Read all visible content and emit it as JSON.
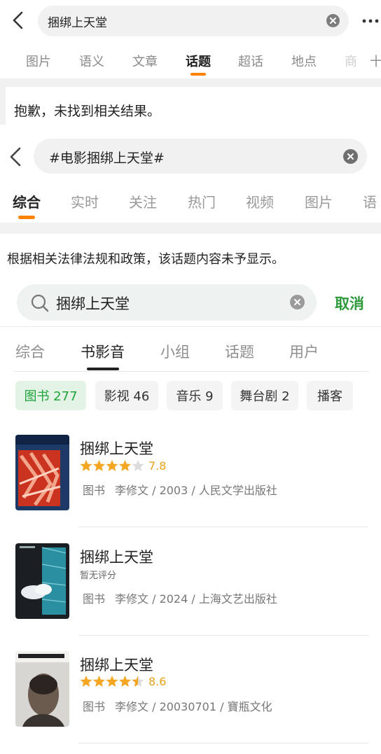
{
  "panel1": {
    "search_query": "捆绑上天堂",
    "tabs": [
      "图片",
      "语义",
      "文章",
      "话题",
      "超话",
      "地点",
      "商",
      "十"
    ],
    "active_tab": "话题",
    "message": "抱歉，未找到相关结果。",
    "accent_color": "#ff8200"
  },
  "panel2": {
    "search_query": "#电影捆绑上天堂#",
    "tabs": [
      "综合",
      "实时",
      "关注",
      "热门",
      "视频",
      "图片",
      "语"
    ],
    "active_tab": "综合",
    "message": "根据相关法律法规和政策，该话题内容未予显示。",
    "accent_color": "#ff8200"
  },
  "panel3": {
    "search_query": "捆绑上天堂",
    "cancel_label": "取消",
    "tabs": [
      "综合",
      "书影音",
      "小组",
      "话题",
      "用户"
    ],
    "active_tab": "书影音",
    "chips": [
      "图书 277",
      "影视 46",
      "音乐 9",
      "舞台剧 2",
      "播客"
    ],
    "active_chip": "图书 277",
    "accent_color": "#2e9a3c",
    "results": [
      {
        "title": "捆绑上天堂",
        "rating": "7.8",
        "stars": 4,
        "type": "图书",
        "info": "李修文 / 2003 / 人民文学出版社"
      },
      {
        "title": "捆绑上天堂",
        "rating_text": "暂无评分",
        "type": "图书",
        "info": "李修文 / 2024 / 上海文艺出版社"
      },
      {
        "title": "捆绑上天堂",
        "rating": "8.6",
        "stars": 4.5,
        "type": "图书",
        "info": "李修文 / 20030701 / 寶瓶文化"
      }
    ]
  }
}
